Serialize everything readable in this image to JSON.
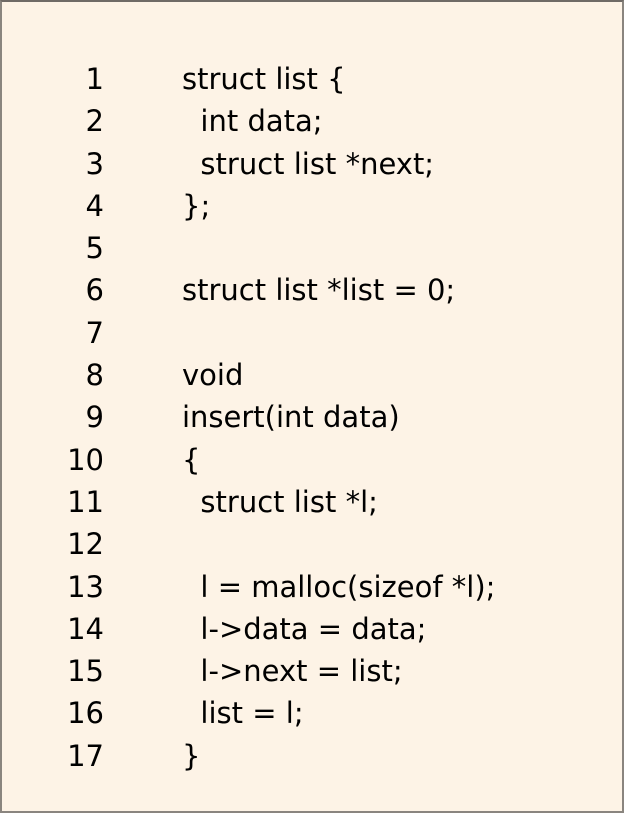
{
  "code": {
    "lines": [
      {
        "num": "1",
        "text": "struct list {"
      },
      {
        "num": "2",
        "text": "  int data;"
      },
      {
        "num": "3",
        "text": "  struct list *next;"
      },
      {
        "num": "4",
        "text": "};"
      },
      {
        "num": "5",
        "text": ""
      },
      {
        "num": "6",
        "text": "struct list *list = 0;"
      },
      {
        "num": "7",
        "text": ""
      },
      {
        "num": "8",
        "text": "void"
      },
      {
        "num": "9",
        "text": "insert(int data)"
      },
      {
        "num": "10",
        "text": "{"
      },
      {
        "num": "11",
        "text": "  struct list *l;"
      },
      {
        "num": "12",
        "text": ""
      },
      {
        "num": "13",
        "text": "  l = malloc(sizeof *l);"
      },
      {
        "num": "14",
        "text": "  l->data = data;"
      },
      {
        "num": "15",
        "text": "  l->next = list;"
      },
      {
        "num": "16",
        "text": "  list = l;"
      },
      {
        "num": "17",
        "text": "}"
      }
    ]
  }
}
